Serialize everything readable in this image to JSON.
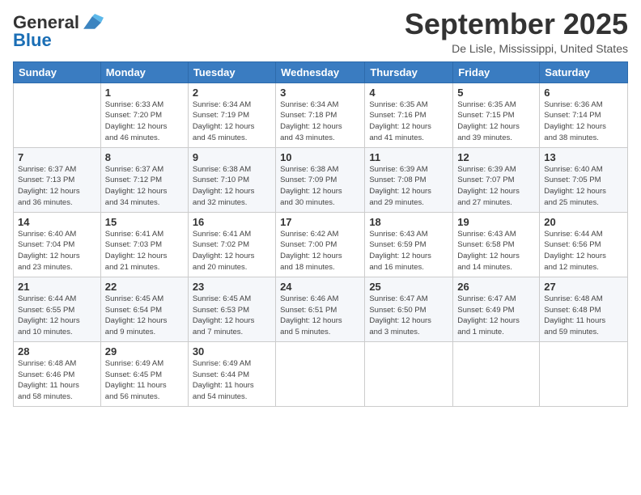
{
  "logo": {
    "line1": "General",
    "line2": "Blue"
  },
  "header": {
    "month": "September 2025",
    "location": "De Lisle, Mississippi, United States"
  },
  "days_of_week": [
    "Sunday",
    "Monday",
    "Tuesday",
    "Wednesday",
    "Thursday",
    "Friday",
    "Saturday"
  ],
  "weeks": [
    [
      {
        "day": "",
        "info": ""
      },
      {
        "day": "1",
        "info": "Sunrise: 6:33 AM\nSunset: 7:20 PM\nDaylight: 12 hours\nand 46 minutes."
      },
      {
        "day": "2",
        "info": "Sunrise: 6:34 AM\nSunset: 7:19 PM\nDaylight: 12 hours\nand 45 minutes."
      },
      {
        "day": "3",
        "info": "Sunrise: 6:34 AM\nSunset: 7:18 PM\nDaylight: 12 hours\nand 43 minutes."
      },
      {
        "day": "4",
        "info": "Sunrise: 6:35 AM\nSunset: 7:16 PM\nDaylight: 12 hours\nand 41 minutes."
      },
      {
        "day": "5",
        "info": "Sunrise: 6:35 AM\nSunset: 7:15 PM\nDaylight: 12 hours\nand 39 minutes."
      },
      {
        "day": "6",
        "info": "Sunrise: 6:36 AM\nSunset: 7:14 PM\nDaylight: 12 hours\nand 38 minutes."
      }
    ],
    [
      {
        "day": "7",
        "info": "Sunrise: 6:37 AM\nSunset: 7:13 PM\nDaylight: 12 hours\nand 36 minutes."
      },
      {
        "day": "8",
        "info": "Sunrise: 6:37 AM\nSunset: 7:12 PM\nDaylight: 12 hours\nand 34 minutes."
      },
      {
        "day": "9",
        "info": "Sunrise: 6:38 AM\nSunset: 7:10 PM\nDaylight: 12 hours\nand 32 minutes."
      },
      {
        "day": "10",
        "info": "Sunrise: 6:38 AM\nSunset: 7:09 PM\nDaylight: 12 hours\nand 30 minutes."
      },
      {
        "day": "11",
        "info": "Sunrise: 6:39 AM\nSunset: 7:08 PM\nDaylight: 12 hours\nand 29 minutes."
      },
      {
        "day": "12",
        "info": "Sunrise: 6:39 AM\nSunset: 7:07 PM\nDaylight: 12 hours\nand 27 minutes."
      },
      {
        "day": "13",
        "info": "Sunrise: 6:40 AM\nSunset: 7:05 PM\nDaylight: 12 hours\nand 25 minutes."
      }
    ],
    [
      {
        "day": "14",
        "info": "Sunrise: 6:40 AM\nSunset: 7:04 PM\nDaylight: 12 hours\nand 23 minutes."
      },
      {
        "day": "15",
        "info": "Sunrise: 6:41 AM\nSunset: 7:03 PM\nDaylight: 12 hours\nand 21 minutes."
      },
      {
        "day": "16",
        "info": "Sunrise: 6:41 AM\nSunset: 7:02 PM\nDaylight: 12 hours\nand 20 minutes."
      },
      {
        "day": "17",
        "info": "Sunrise: 6:42 AM\nSunset: 7:00 PM\nDaylight: 12 hours\nand 18 minutes."
      },
      {
        "day": "18",
        "info": "Sunrise: 6:43 AM\nSunset: 6:59 PM\nDaylight: 12 hours\nand 16 minutes."
      },
      {
        "day": "19",
        "info": "Sunrise: 6:43 AM\nSunset: 6:58 PM\nDaylight: 12 hours\nand 14 minutes."
      },
      {
        "day": "20",
        "info": "Sunrise: 6:44 AM\nSunset: 6:56 PM\nDaylight: 12 hours\nand 12 minutes."
      }
    ],
    [
      {
        "day": "21",
        "info": "Sunrise: 6:44 AM\nSunset: 6:55 PM\nDaylight: 12 hours\nand 10 minutes."
      },
      {
        "day": "22",
        "info": "Sunrise: 6:45 AM\nSunset: 6:54 PM\nDaylight: 12 hours\nand 9 minutes."
      },
      {
        "day": "23",
        "info": "Sunrise: 6:45 AM\nSunset: 6:53 PM\nDaylight: 12 hours\nand 7 minutes."
      },
      {
        "day": "24",
        "info": "Sunrise: 6:46 AM\nSunset: 6:51 PM\nDaylight: 12 hours\nand 5 minutes."
      },
      {
        "day": "25",
        "info": "Sunrise: 6:47 AM\nSunset: 6:50 PM\nDaylight: 12 hours\nand 3 minutes."
      },
      {
        "day": "26",
        "info": "Sunrise: 6:47 AM\nSunset: 6:49 PM\nDaylight: 12 hours\nand 1 minute."
      },
      {
        "day": "27",
        "info": "Sunrise: 6:48 AM\nSunset: 6:48 PM\nDaylight: 11 hours\nand 59 minutes."
      }
    ],
    [
      {
        "day": "28",
        "info": "Sunrise: 6:48 AM\nSunset: 6:46 PM\nDaylight: 11 hours\nand 58 minutes."
      },
      {
        "day": "29",
        "info": "Sunrise: 6:49 AM\nSunset: 6:45 PM\nDaylight: 11 hours\nand 56 minutes."
      },
      {
        "day": "30",
        "info": "Sunrise: 6:49 AM\nSunset: 6:44 PM\nDaylight: 11 hours\nand 54 minutes."
      },
      {
        "day": "",
        "info": ""
      },
      {
        "day": "",
        "info": ""
      },
      {
        "day": "",
        "info": ""
      },
      {
        "day": "",
        "info": ""
      }
    ]
  ]
}
